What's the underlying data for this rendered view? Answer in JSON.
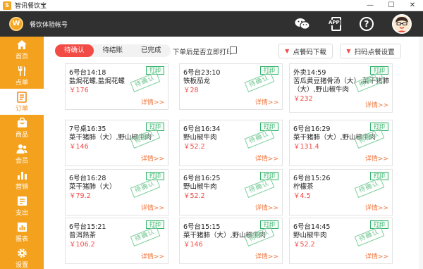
{
  "window": {
    "title": "智讯餐饮宝",
    "icon_char": "S",
    "controls": [
      "—",
      "☐",
      "✕"
    ]
  },
  "header": {
    "logo_char": "W",
    "account_name": "餐饮体验帐号",
    "app_badge": "APP",
    "help": "?"
  },
  "sidebar": {
    "items": [
      {
        "label": "首页",
        "icon": "home-icon"
      },
      {
        "label": "点单",
        "icon": "cutlery-icon"
      },
      {
        "label": "订单",
        "icon": "order-list-icon",
        "active": true
      },
      {
        "label": "商品",
        "icon": "bag-icon"
      },
      {
        "label": "会员",
        "icon": "members-icon"
      },
      {
        "label": "营销",
        "icon": "chart-bars-icon"
      },
      {
        "label": "支出",
        "icon": "expense-icon"
      },
      {
        "label": "报表",
        "icon": "report-icon"
      },
      {
        "label": "设置",
        "icon": "gear-icon"
      }
    ]
  },
  "toolbar": {
    "tabs": [
      "待确认",
      "待结账",
      "已完成"
    ],
    "active_tab": 0,
    "print_toggle_label": "下单后是否立即打印",
    "print_toggle_checked": false,
    "download_label": "点餐码下载",
    "settings_label": "扫码点餐设置"
  },
  "cards_common": {
    "print_label": "打印",
    "stamp_label": "待确认",
    "detail_label": "详情>>"
  },
  "orders": [
    {
      "title": "6号台14:18",
      "items": "盐焗花螺,盐焗花螺",
      "price": "￥176"
    },
    {
      "title": "6号台23:10",
      "items": "铁板茄龙",
      "price": "￥28"
    },
    {
      "title": "外卖14:59",
      "items": "苦瓜黄豆猪骨汤（大）,菜干猪肺",
      "items2": "（大）,野山椒牛肉",
      "price": "￥232"
    },
    {
      "title": "7号桌16:35",
      "items": "菜干猪肺（大）,野山椒牛肉",
      "price": "￥146"
    },
    {
      "title": "6号台16:34",
      "items": "野山椒牛肉",
      "price": "￥52.2"
    },
    {
      "title": "6号台16:29",
      "items": "菜干猪肺（大）,野山椒牛肉",
      "price": "￥131.4"
    },
    {
      "title": "6号台16:28",
      "items": "菜干猪肺（大）",
      "price": "￥79.2"
    },
    {
      "title": "6号台16:25",
      "items": "野山椒牛肉",
      "price": "￥52.2"
    },
    {
      "title": "6号台15:26",
      "items": "柠檬茶",
      "price": "￥4.5"
    },
    {
      "title": "6号台15:21",
      "items": "普洱熟茶",
      "price": "￥106.2"
    },
    {
      "title": "6号台15:15",
      "items": "菜干猪肺（大）,野山椒牛肉",
      "price": "￥146"
    },
    {
      "title": "6号台14:45",
      "items": "野山椒牛肉",
      "price": "￥52.2"
    }
  ],
  "colors": {
    "sidebar": "#f4a21d",
    "header": "#303030",
    "accent_red": "#f24a45",
    "stamp_green": "#35b36b",
    "detail_orange": "#f0733a"
  }
}
